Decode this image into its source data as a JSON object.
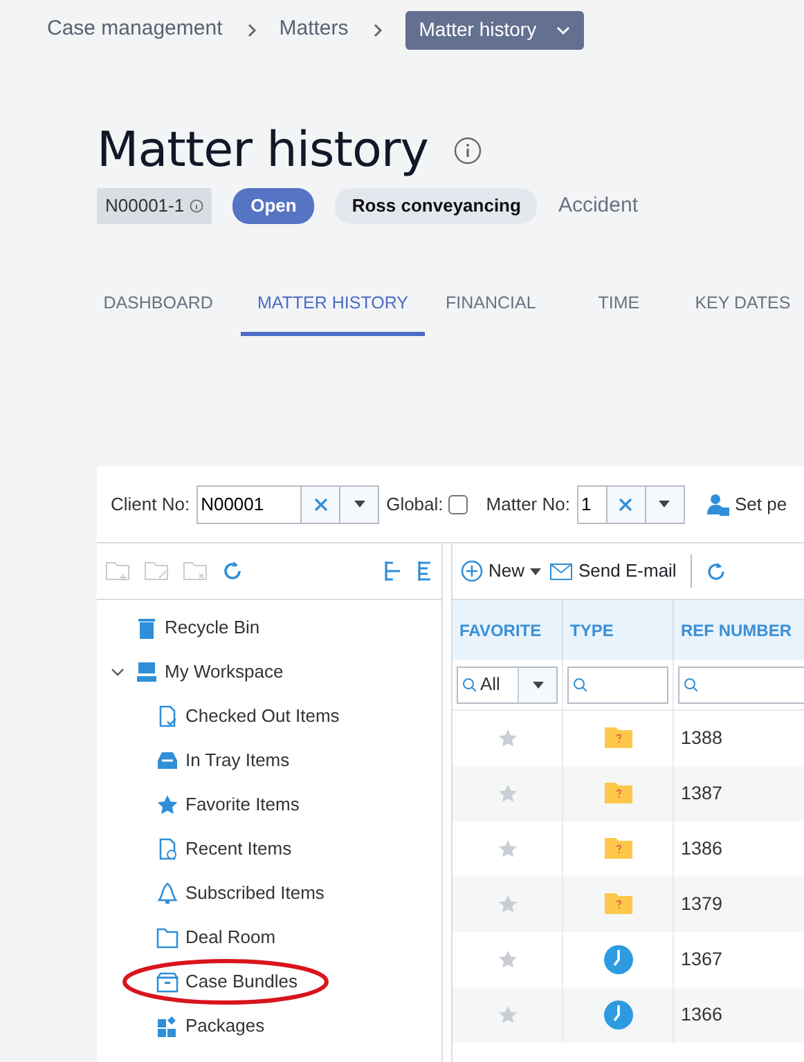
{
  "breadcrumb": {
    "items": [
      {
        "label": "Case management"
      },
      {
        "label": "Matters"
      }
    ],
    "current": "Matter history"
  },
  "title": "Matter history",
  "tags": {
    "matter_id": "N00001-1",
    "status": "Open",
    "client": "Ross conveyancing",
    "matter_type": "Accident"
  },
  "tabs": [
    {
      "label": "DASHBOARD",
      "selected": false
    },
    {
      "label": "MATTER HISTORY",
      "selected": true
    },
    {
      "label": "FINANCIAL",
      "selected": false
    },
    {
      "label": "TIME",
      "selected": false
    },
    {
      "label": "KEY DATES",
      "selected": false
    }
  ],
  "filters": {
    "client_no": {
      "label": "Client No:",
      "value": "N00001"
    },
    "global": {
      "label": "Global:",
      "checked": false
    },
    "matter_no": {
      "label": "Matter No:",
      "value": "1"
    },
    "set_button": {
      "label": "Set pe"
    }
  },
  "tree": [
    {
      "label": "Recycle Bin",
      "kind": "bin",
      "circled": false
    },
    {
      "label": "My Workspace",
      "kind": "workspace",
      "circled": false,
      "expanded": true,
      "children": [
        {
          "label": "Checked Out Items",
          "kind": "checked-out",
          "circled": false
        },
        {
          "label": "In Tray Items",
          "kind": "tray",
          "circled": false
        },
        {
          "label": "Favorite Items",
          "kind": "star",
          "circled": false
        },
        {
          "label": "Recent Items",
          "kind": "recent",
          "circled": false
        },
        {
          "label": "Subscribed Items",
          "kind": "bell",
          "circled": false
        },
        {
          "label": "Deal Room",
          "kind": "folder",
          "circled": false
        },
        {
          "label": "Case Bundles",
          "kind": "bundle",
          "circled": true
        },
        {
          "label": "Packages",
          "kind": "packages",
          "circled": false
        }
      ]
    }
  ],
  "grid_toolbar": {
    "new": "New",
    "send_email": "Send E-mail"
  },
  "grid": {
    "columns": [
      "FAVORITE",
      "TYPE",
      "REF NUMBER"
    ],
    "favorite_filter": "All",
    "rows": [
      {
        "favorite": false,
        "kind": "folder",
        "ref": "1388"
      },
      {
        "favorite": false,
        "kind": "folder",
        "ref": "1387"
      },
      {
        "favorite": false,
        "kind": "folder",
        "ref": "1386"
      },
      {
        "favorite": false,
        "kind": "folder",
        "ref": "1379"
      },
      {
        "favorite": false,
        "kind": "clock",
        "ref": "1367"
      },
      {
        "favorite": false,
        "kind": "clock",
        "ref": "1366"
      }
    ]
  }
}
